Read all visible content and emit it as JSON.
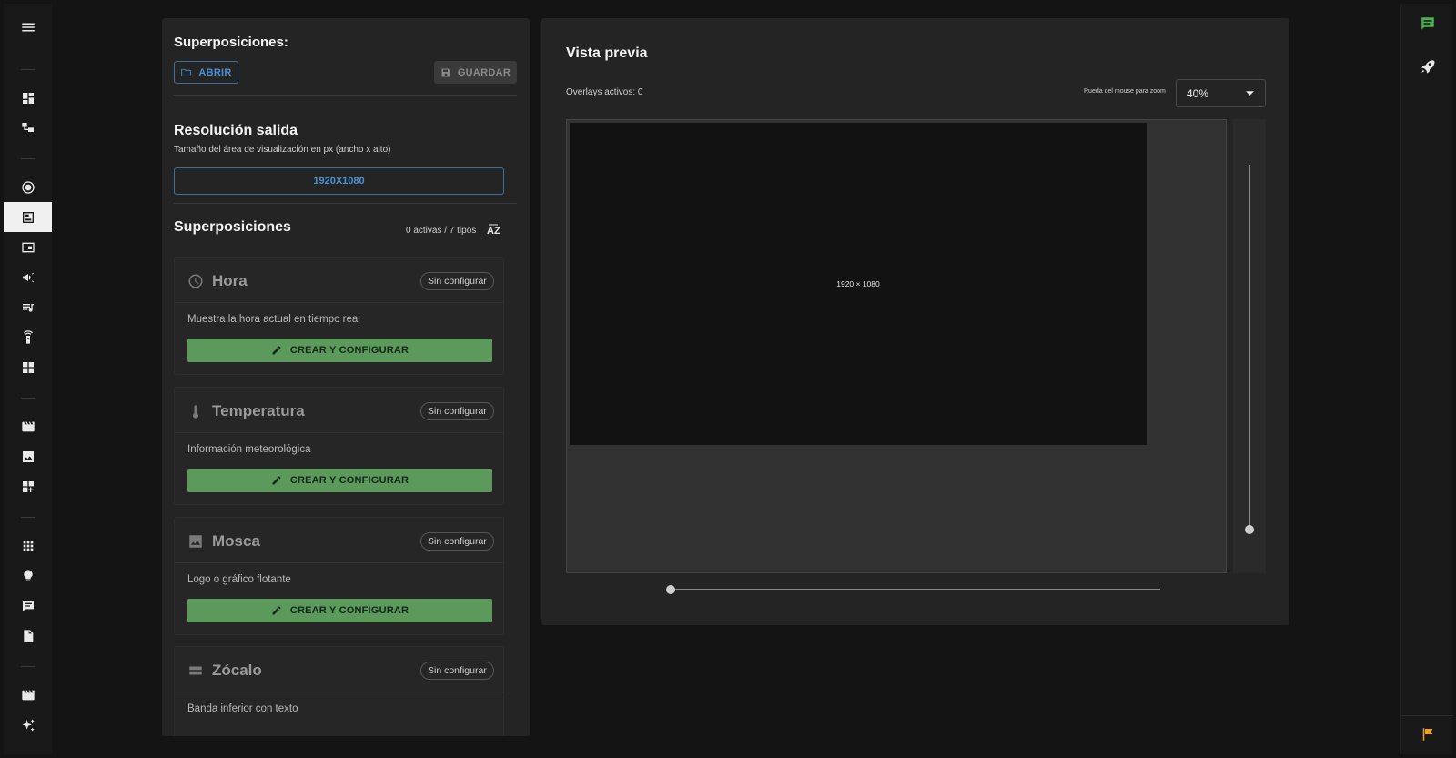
{
  "left_panel": {
    "overlays_heading": "Superposiciones:",
    "open_label": "ABRIR",
    "save_label": "GUARDAR",
    "resolution": {
      "title": "Resolución salida",
      "subtitle": "Tamaño del área de visualización en px (ancho x alto)",
      "value": "1920X1080"
    },
    "list": {
      "title": "Superposiciones",
      "count_text": "0 activas / 7 tipos",
      "cards": [
        {
          "title": "Hora",
          "icon": "clock-icon",
          "status": "Sin configurar",
          "description": "Muestra la hora actual en tiempo real",
          "action": "CREAR Y CONFIGURAR"
        },
        {
          "title": "Temperatura",
          "icon": "thermometer-icon",
          "status": "Sin configurar",
          "description": "Información meteorológica",
          "action": "CREAR Y CONFIGURAR"
        },
        {
          "title": "Mosca",
          "icon": "image-icon",
          "status": "Sin configurar",
          "description": "Logo o gráfico flotante",
          "action": "CREAR Y CONFIGURAR"
        },
        {
          "title": "Zócalo",
          "icon": "lower-third-icon",
          "status": "Sin configurar",
          "description": "Banda inferior con texto",
          "action": ""
        }
      ]
    }
  },
  "preview": {
    "title": "Vista previa",
    "active_overlays": "Overlays activos: 0",
    "zoom_hint": "Rueda del mouse para zoom",
    "zoom_value": "40%",
    "canvas_label": "1920 × 1080"
  },
  "colors": {
    "accent_blue": "#4a90d6",
    "action_green": "#5b9a5b",
    "panel_bg": "#242424",
    "page_bg": "#141414",
    "rail_chat": "#4caf50",
    "rail_flag": "#f0a020"
  },
  "nav_icons": [
    "menu-icon",
    "dashboard-icon",
    "hierarchy-icon",
    "record-icon",
    "overlay-icon",
    "picture-in-picture-icon",
    "megaphone-icon",
    "playlist-icon",
    "remote-icon",
    "widgets-icon",
    "movie-icon",
    "image-icon",
    "add-widget-icon",
    "apps-grid-icon",
    "lightbulb-icon",
    "chat-icon",
    "document-icon",
    "film-icon",
    "sparkle-icon"
  ],
  "rail_icons": [
    "chat-icon",
    "rocket-icon",
    "flag-icon"
  ]
}
